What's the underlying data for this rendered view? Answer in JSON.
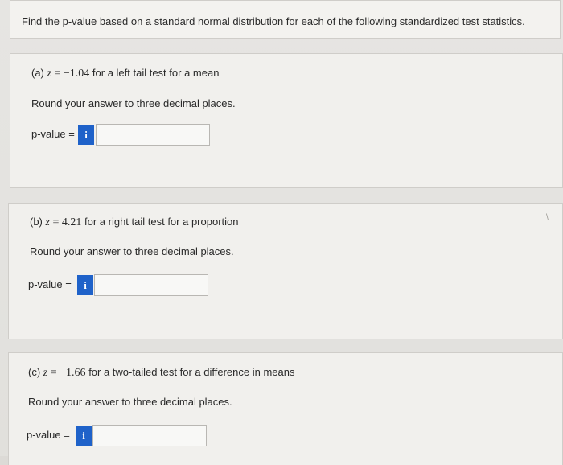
{
  "header": {
    "prompt": "Find the p-value based on a standard normal distribution for each of the following standardized test statistics."
  },
  "parts": [
    {
      "label": "(a)",
      "z_var": "z",
      "equals": "=",
      "z_value": "−1.04",
      "description": "for a left tail test for a mean",
      "round_instruction": "Round your answer to three decimal places.",
      "pvalue_label": "p-value =",
      "info_glyph": "i",
      "answer": ""
    },
    {
      "label": "(b)",
      "z_var": "z",
      "equals": "=",
      "z_value": "4.21",
      "description": "for a right tail test for a proportion",
      "round_instruction": "Round your answer to three decimal places.",
      "pvalue_label": "p-value =",
      "info_glyph": "i",
      "answer": ""
    },
    {
      "label": "(c)",
      "z_var": "z",
      "equals": "=",
      "z_value": "−1.66",
      "description": "for a two-tailed test for a difference in means",
      "round_instruction": "Round your answer to three decimal places.",
      "pvalue_label": "p-value =",
      "info_glyph": "i",
      "answer": ""
    }
  ],
  "colors": {
    "info_button": "#1f62c9",
    "card_background": "#f1f0ed",
    "page_background": "#e4e3e0"
  }
}
